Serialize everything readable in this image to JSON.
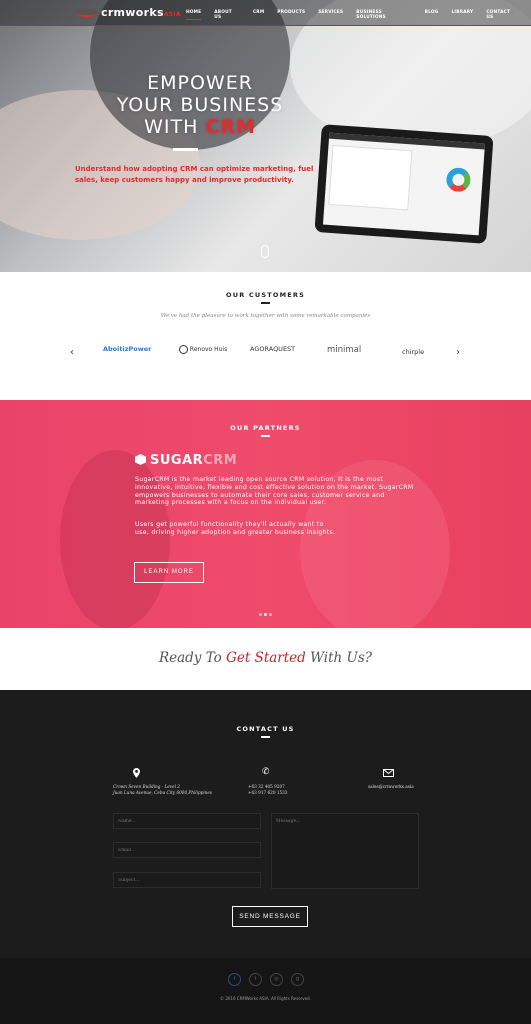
{
  "nav": {
    "logo": "crmworks",
    "logo_suffix": "ASIA",
    "items": [
      "HOME",
      "ABOUT US",
      "CRM",
      "PRODUCTS",
      "SERVICES",
      "BUSINESS SOLUTIONS",
      "BLOG",
      "LIBRARY",
      "CONTACT US"
    ],
    "active": "HOME"
  },
  "hero": {
    "line1": "EMPOWER",
    "line2": "YOUR BUSINESS",
    "line3_prefix": "WITH ",
    "line3_accent": "CRM",
    "subtitle": "Understand how adopting CRM can optimize marketing, fuel sales, keep customers happy and improve productivity."
  },
  "customers": {
    "title": "OUR CUSTOMERS",
    "subtitle": "We've had the pleasure to work together with some remarkable companies",
    "logos": [
      "AboitizPower",
      "Renovo Huis",
      "AGORAQUEST",
      "minimal",
      "chirple"
    ],
    "prev": "‹",
    "next": "›"
  },
  "partners": {
    "title": "OUR PARTNERS",
    "brand": "SUGAR",
    "brand_accent": "CRM",
    "para1": "SugarCRM is the market leading open source CRM solution. It is the most innovative, intuitive, flexible and cost effective solution on the market. SugarCRM empowers businesses to automate their core sales, customer service and marketing processes with a focus on the individual user.",
    "para2": "Users get powerful functionality they'll actually want to use, driving higher adoption and greater business insights.",
    "button": "LEARN MORE"
  },
  "cta": {
    "prefix": "Ready To ",
    "accent": "Get Started",
    "suffix": " With Us?"
  },
  "contact": {
    "title": "CONTACT US",
    "address1": "Crown Seven Building - Level 2",
    "address2": "Juan Luna Avenue, Cebu City 6000,Philippines",
    "phone1": "+63 32 405 9207",
    "phone2": "+63 917 620 1533",
    "email": "sales@crmworks.asia",
    "name_placeholder": "Name...",
    "email_placeholder": "Email...",
    "subject_placeholder": "Subject...",
    "message_placeholder": "Message...",
    "send": "SEND MESSAGE"
  },
  "footer": {
    "social": [
      "f",
      "t",
      "◎",
      "g"
    ],
    "copyright": "© 2016 CRMWorks ASIA. All Rights Reserved."
  },
  "colors": {
    "accent": "#e32b2b",
    "partners_bg": "#ec4668",
    "dark": "#1c1c1c"
  }
}
